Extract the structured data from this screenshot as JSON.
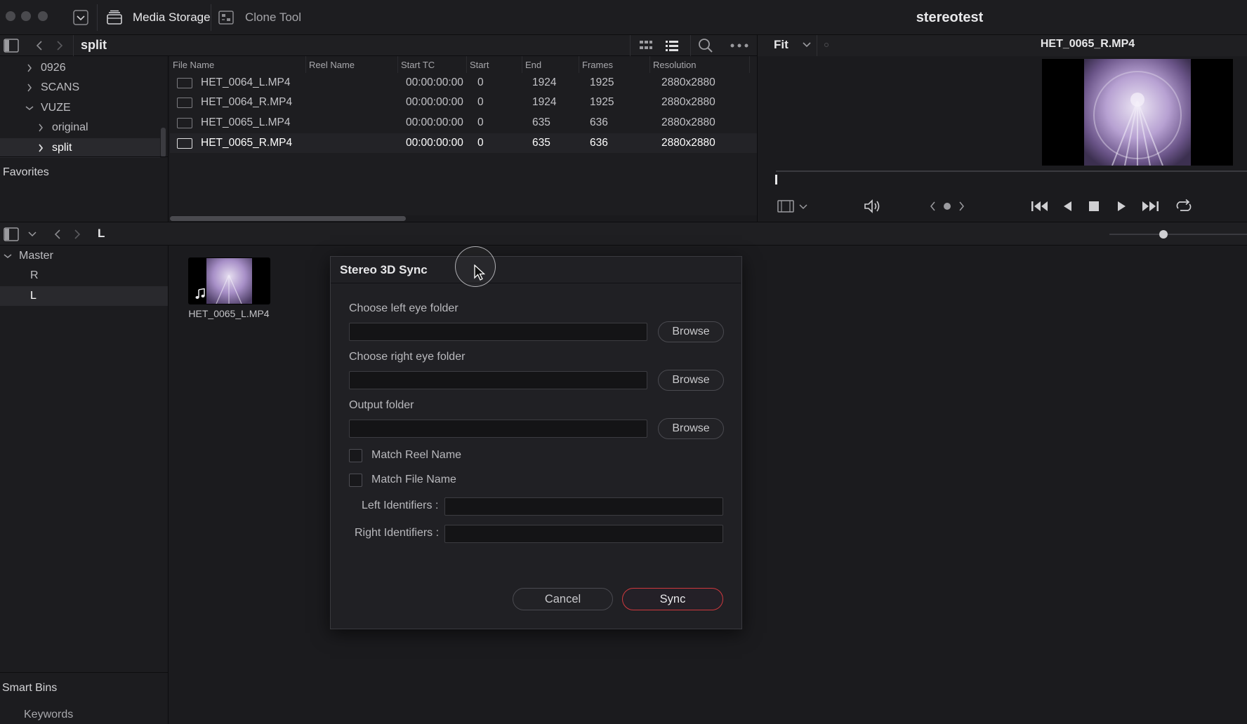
{
  "topbar": {
    "media_storage_label": "Media Storage",
    "clone_tool_label": "Clone Tool",
    "project_title": "stereotest"
  },
  "browser": {
    "path_label": "split",
    "tree": [
      {
        "label": "0926"
      },
      {
        "label": "SCANS"
      },
      {
        "label": "VUZE"
      },
      {
        "label": "original"
      },
      {
        "label": "split"
      }
    ],
    "favorites_label": "Favorites"
  },
  "filelist": {
    "columns": [
      "File Name",
      "Reel Name",
      "Start TC",
      "Start",
      "End",
      "Frames",
      "Resolution"
    ],
    "rows": [
      {
        "name": "HET_0064_L.MP4",
        "start_tc": "00:00:00:00",
        "start": "0",
        "end": "1924",
        "frames": "1925",
        "resolution": "2880x2880"
      },
      {
        "name": "HET_0064_R.MP4",
        "start_tc": "00:00:00:00",
        "start": "0",
        "end": "1924",
        "frames": "1925",
        "resolution": "2880x2880"
      },
      {
        "name": "HET_0065_L.MP4",
        "start_tc": "00:00:00:00",
        "start": "0",
        "end": "635",
        "frames": "636",
        "resolution": "2880x2880"
      },
      {
        "name": "HET_0065_R.MP4",
        "start_tc": "00:00:00:00",
        "start": "0",
        "end": "635",
        "frames": "636",
        "resolution": "2880x2880"
      }
    ]
  },
  "viewer": {
    "zoom_label": "Fit",
    "clip_title": "HET_0065_R.MP4"
  },
  "media_pool": {
    "bin_label": "L",
    "bins": [
      {
        "label": "Master"
      },
      {
        "label": "R"
      },
      {
        "label": "L"
      }
    ],
    "smart_bins_label": "Smart Bins",
    "keywords_label": "Keywords",
    "clip_name": "HET_0065_L.MP4"
  },
  "dialog": {
    "title": "Stereo 3D Sync",
    "left_folder_label": "Choose left eye folder",
    "right_folder_label": "Choose right eye folder",
    "output_folder_label": "Output folder",
    "browse_label": "Browse",
    "match_reel_label": "Match Reel Name",
    "match_file_label": "Match File Name",
    "left_ident_label": "Left Identifiers :",
    "right_ident_label": "Right Identifiers :",
    "cancel_label": "Cancel",
    "sync_label": "Sync"
  },
  "colors": {
    "accent_red": "#d0393e",
    "background": "#1b1b1e",
    "text_primary": "#e8e8ea"
  }
}
